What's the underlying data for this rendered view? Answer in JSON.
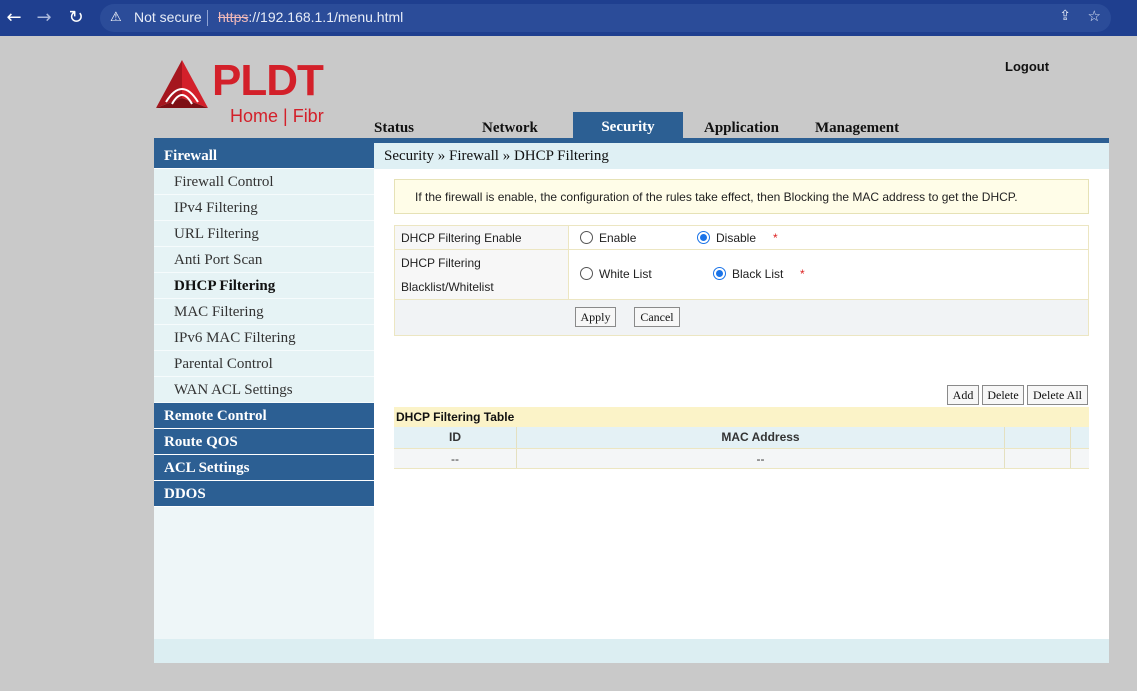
{
  "browser": {
    "nav": {
      "back": "←",
      "forward": "→",
      "reload": "↻"
    },
    "security_warning": "Not secure",
    "url_protocol": "https",
    "url_rest": "://192.168.1.1/menu.html",
    "icons": {
      "warning": "⚠",
      "share": "⇪",
      "star": "☆"
    }
  },
  "header": {
    "brand": "PLDT",
    "tagline": "Home | Fibr",
    "logout": "Logout",
    "brand_color": "#d3202a"
  },
  "topnav": {
    "tabs": [
      {
        "label": "Status"
      },
      {
        "label": "Network"
      },
      {
        "label": "Security"
      },
      {
        "label": "Application"
      },
      {
        "label": "Management"
      }
    ],
    "active": "Security",
    "accent": "#2c5f93"
  },
  "sidebar": {
    "firewall": "Firewall",
    "items": [
      {
        "label": "Firewall Control"
      },
      {
        "label": "IPv4 Filtering"
      },
      {
        "label": "URL Filtering"
      },
      {
        "label": "Anti Port Scan"
      },
      {
        "label": "DHCP Filtering"
      },
      {
        "label": "MAC Filtering"
      },
      {
        "label": "IPv6 MAC Filtering"
      },
      {
        "label": "Parental Control"
      },
      {
        "label": "WAN ACL Settings"
      }
    ],
    "active_item": "DHCP Filtering",
    "sections": [
      {
        "label": "Remote Control"
      },
      {
        "label": "Route QOS"
      },
      {
        "label": "ACL Settings"
      },
      {
        "label": "DDOS"
      }
    ]
  },
  "content": {
    "breadcrumb": "Security » Firewall » DHCP Filtering",
    "note": "If the firewall is enable, the configuration of the rules take effect, then Blocking the MAC address to get the DHCP.",
    "enable_row": {
      "label": "DHCP Filtering Enable",
      "options": [
        "Enable",
        "Disable"
      ],
      "selected": "Disable",
      "required": "*"
    },
    "list_row": {
      "label_line1": "DHCP Filtering",
      "label_line2": "Blacklist/Whitelist",
      "options": [
        "White List",
        "Black List"
      ],
      "selected": "Black List",
      "required": "*"
    },
    "apply": "Apply",
    "cancel": "Cancel",
    "table_buttons": {
      "add": "Add",
      "delete": "Delete",
      "delete_all": "Delete All"
    },
    "table": {
      "title": "DHCP Filtering Table",
      "columns": [
        "ID",
        "MAC Address"
      ],
      "rows": [
        [
          "--",
          "--"
        ]
      ]
    }
  }
}
